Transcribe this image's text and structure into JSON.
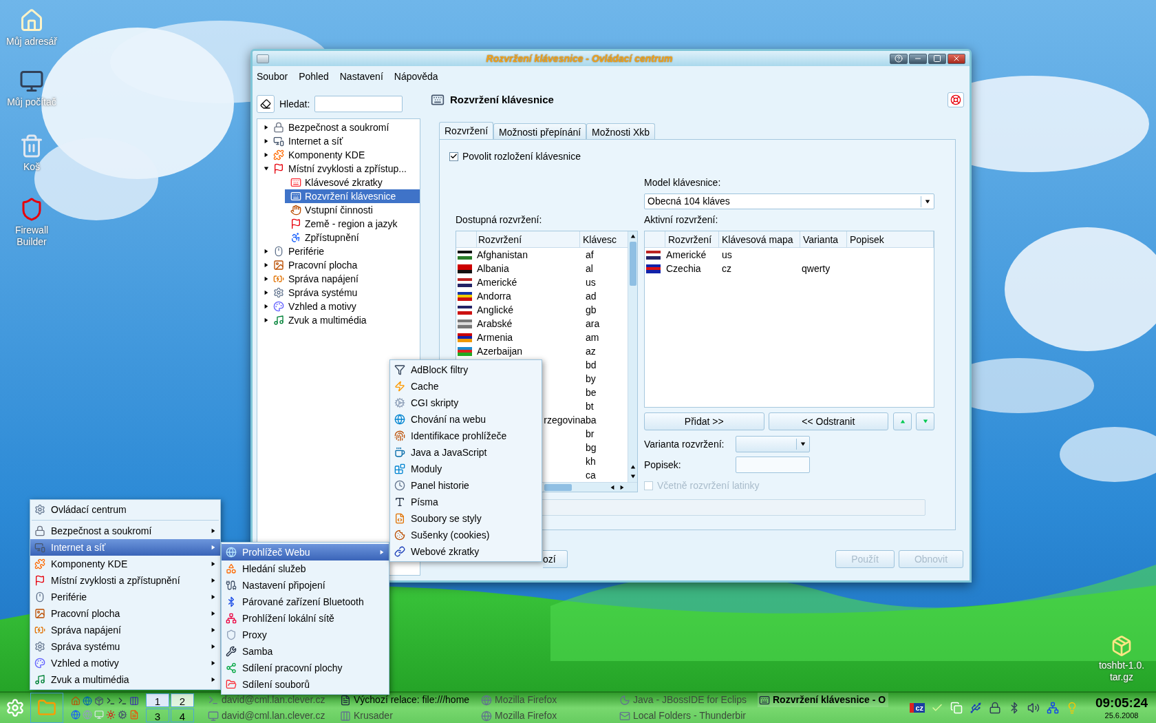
{
  "desktop_icons": [
    {
      "label": "Můj adresář"
    },
    {
      "label": "Můj počítač"
    },
    {
      "label": "Koš"
    },
    {
      "label": "Firewall Builder"
    }
  ],
  "desktop_file": {
    "label": "toshbt-1.0.tar.gz"
  },
  "window": {
    "title": "Rozvržení klávesnice - Ovládací centrum",
    "menu": [
      "Soubor",
      "Pohled",
      "Nastavení",
      "Nápověda"
    ],
    "search": {
      "label": "Hledat:"
    },
    "tree": [
      {
        "label": "Bezpečnost a soukromí",
        "expanded": false,
        "selected": false
      },
      {
        "label": "Internet a síť",
        "expanded": false,
        "selected": false
      },
      {
        "label": "Komponenty KDE",
        "expanded": false,
        "selected": false
      },
      {
        "label": "Místní zvyklosti a zpřístup...",
        "expanded": true,
        "selected": false,
        "children": [
          {
            "label": "Klávesové zkratky",
            "selected": false
          },
          {
            "label": "Rozvržení klávesnice",
            "selected": true
          },
          {
            "label": "Vstupní činnosti",
            "selected": false
          },
          {
            "label": "Země - region a jazyk",
            "selected": false
          },
          {
            "label": "Zpřístupnění",
            "selected": false
          }
        ]
      },
      {
        "label": "Periférie",
        "expanded": false,
        "selected": false
      },
      {
        "label": "Pracovní plocha",
        "expanded": false,
        "selected": false
      },
      {
        "label": "Správa napájení",
        "expanded": false,
        "selected": false
      },
      {
        "label": "Správa systému",
        "expanded": false,
        "selected": false
      },
      {
        "label": "Vzhled a motivy",
        "expanded": false,
        "selected": false
      },
      {
        "label": "Zvuk a multimédia",
        "expanded": false,
        "selected": false
      }
    ],
    "module_title": "Rozvržení klávesnice",
    "tabs": [
      {
        "label": "Rozvržení",
        "selected": true
      },
      {
        "label": "Možnosti přepínání",
        "selected": false
      },
      {
        "label": "Možnosti Xkb",
        "selected": false
      }
    ],
    "enable_checkbox": {
      "label": "Povolit rozložení klávesnice",
      "checked": true
    },
    "model": {
      "label": "Model klávesnice:",
      "value": "Obecná 104 kláves"
    },
    "available": {
      "label": "Dostupná rozvržení:",
      "columns": [
        "Rozvržení",
        "Klávesc"
      ],
      "rows": [
        {
          "name": "Afghanistan",
          "code": "af"
        },
        {
          "name": "Albania",
          "code": "al"
        },
        {
          "name": "Americké",
          "code": "us"
        },
        {
          "name": "Andorra",
          "code": "ad"
        },
        {
          "name": "Anglické",
          "code": "gb"
        },
        {
          "name": "Arabské",
          "code": "ara"
        },
        {
          "name": "Armenia",
          "code": "am"
        },
        {
          "name": "Azerbaijan",
          "code": "az"
        },
        {
          "code": "bd"
        },
        {
          "code": "by"
        },
        {
          "code": "be"
        },
        {
          "code": "bt"
        },
        {
          "name": "rzegovina",
          "cut": true,
          "code": "ba"
        },
        {
          "code": "br"
        },
        {
          "code": "bg"
        },
        {
          "code": "kh"
        },
        {
          "code": "ca"
        }
      ]
    },
    "active": {
      "label": "Aktivní rozvržení:",
      "columns": [
        "Rozvržení",
        "Klávesová mapa",
        "Varianta",
        "Popisek"
      ],
      "rows": [
        {
          "name": "Americké",
          "map": "us"
        },
        {
          "name": "Czechia",
          "map": "cz",
          "variant": "qwerty"
        }
      ]
    },
    "add_button": "Přidat >>",
    "remove_button": "<< Odstranit",
    "variant": {
      "label": "Varianta rozvržení:"
    },
    "caption": {
      "label": "Popisek:"
    },
    "latin_checkbox": {
      "label": "Včetně rozvržení latinky",
      "checked": false,
      "disabled": true
    },
    "command": {
      "disabled": true
    },
    "footer_buttons": [
      {
        "label": "ozí",
        "cut": true,
        "disabled": false
      },
      {
        "label": "Použít",
        "disabled": true
      },
      {
        "label": "Obnovit",
        "disabled": true
      }
    ]
  },
  "start_menu": {
    "header": "Ovládací centrum",
    "items": [
      {
        "label": "Bezpečnost a soukromí",
        "selected": false
      },
      {
        "label": "Internet a síť",
        "selected": true
      },
      {
        "label": "Komponenty KDE",
        "selected": false
      },
      {
        "label": "Místní zvyklosti a zpřístupnění",
        "selected": false
      },
      {
        "label": "Periférie",
        "selected": false
      },
      {
        "label": "Pracovní plocha",
        "selected": false
      },
      {
        "label": "Správa napájení",
        "selected": false
      },
      {
        "label": "Správa systému",
        "selected": false
      },
      {
        "label": "Vzhled a motivy",
        "selected": false
      },
      {
        "label": "Zvuk a multimédia",
        "selected": false
      }
    ]
  },
  "internet_menu": [
    {
      "label": "Prohlížeč Webu",
      "selected": true,
      "submenu": true
    },
    {
      "label": "Hledání služeb",
      "selected": false,
      "submenu": false
    },
    {
      "label": "Nastavení připojení",
      "selected": false,
      "submenu": false
    },
    {
      "label": "Párované zařízení Bluetooth",
      "selected": false,
      "submenu": false
    },
    {
      "label": "Prohlížení lokální sítě",
      "selected": false,
      "submenu": false
    },
    {
      "label": "Proxy",
      "selected": false,
      "submenu": false
    },
    {
      "label": "Samba",
      "selected": false,
      "submenu": false
    },
    {
      "label": "Sdílení pracovní plochy",
      "selected": false,
      "submenu": false
    },
    {
      "label": "Sdílení souborů",
      "selected": false,
      "submenu": false
    }
  ],
  "browser_menu": [
    {
      "label": "AdBlocK filtry",
      "selected": false
    },
    {
      "label": "Cache",
      "selected": false
    },
    {
      "label": "CGI skripty",
      "selected": false
    },
    {
      "label": "Chování na webu",
      "selected": false
    },
    {
      "label": "Identifikace prohlížeče",
      "selected": false
    },
    {
      "label": "Java a JavaScript",
      "selected": false
    },
    {
      "label": "Moduly",
      "selected": false
    },
    {
      "label": "Panel historie",
      "selected": false
    },
    {
      "label": "Písma",
      "selected": false
    },
    {
      "label": "Soubory se styly",
      "selected": false
    },
    {
      "label": "Sušenky (cookies)",
      "selected": false
    },
    {
      "label": "Webové zkratky",
      "selected": false
    }
  ],
  "taskbar": {
    "pager": [
      {
        "label": "1",
        "selected": true
      },
      {
        "label": "2",
        "selected": false
      },
      {
        "label": "3",
        "selected": false
      },
      {
        "label": "4",
        "selected": false
      }
    ],
    "tasks": [
      {
        "label": "david@cml.lan.clever.cz",
        "active": false,
        "minimized": true
      },
      {
        "label": "Výchozí relace: file:///home",
        "active": false,
        "minimized": false
      },
      {
        "label": "Mozilla Firefox",
        "active": false,
        "minimized": true
      },
      {
        "label": "Java - JBossIDE for Eclips",
        "active": false,
        "minimized": true
      },
      {
        "label": "Rozvržení klávesnice - O",
        "active": true,
        "minimized": false
      },
      {
        "label": "david@cml.lan.clever.cz",
        "active": false,
        "minimized": true
      },
      {
        "label": "Krusader",
        "active": false,
        "minimized": true
      },
      {
        "label": "Mozilla Firefox",
        "active": false,
        "minimized": true
      },
      {
        "label": "Local Folders - Thunderbir",
        "active": false,
        "minimized": true
      }
    ],
    "tray_flag": "cz",
    "time": "09:05:24",
    "date": "25.6.2008"
  }
}
